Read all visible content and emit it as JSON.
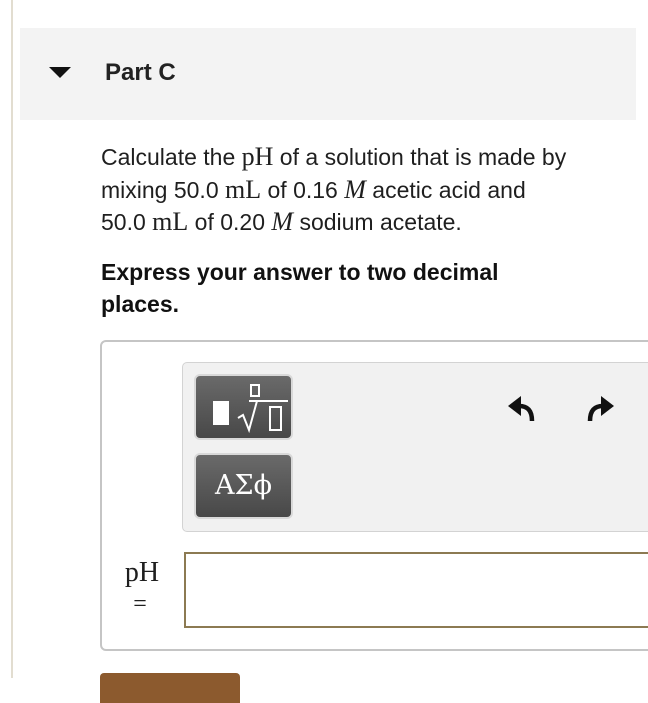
{
  "part": {
    "title": "Part C"
  },
  "question": {
    "line1": {
      "before": "Calculate the ",
      "quantity": "pH",
      "after": " of a solution that is made by"
    },
    "line2": {
      "before": "mixing 50.0 ",
      "unit1": "mL",
      "middle": " of 0.16 ",
      "unit2": "M",
      "after": " acetic acid and"
    },
    "line3": {
      "before": "50.0 ",
      "unit1": "mL",
      "middle": " of 0.20 ",
      "unit2": "M",
      "after": " sodium acetate."
    }
  },
  "instruction": {
    "line1": "Express your answer to two decimal",
    "line2": "places."
  },
  "toolbar": {
    "templates_icon": "templates-radical-icon",
    "symbols_label": "ΑΣϕ",
    "undo_icon": "undo-arrow-icon",
    "redo_icon": "redo-arrow-icon"
  },
  "answer": {
    "variable": "pH",
    "equals": "=",
    "value": "",
    "placeholder": ""
  },
  "colors": {
    "header_bg": "#f3f3f3",
    "input_border": "#8c7a52",
    "tool_button_bg": "#555555",
    "submit_button": "#8c5a2e"
  }
}
